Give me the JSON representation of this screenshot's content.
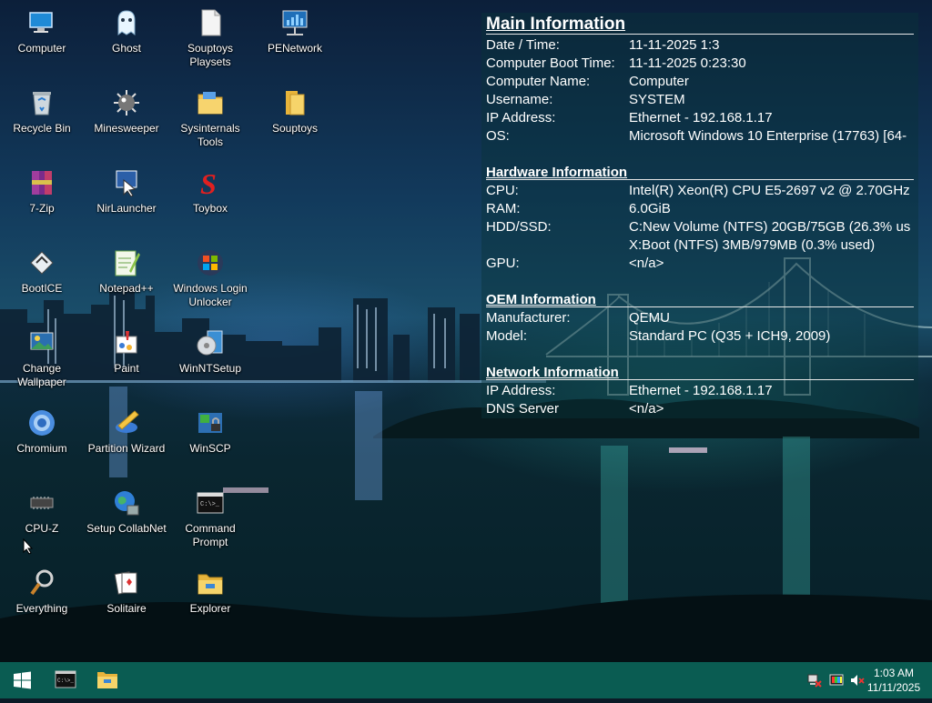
{
  "desktop": {
    "icons": [
      {
        "label": "Computer",
        "icon": "computer-icon"
      },
      {
        "label": "Ghost",
        "icon": "ghost-icon"
      },
      {
        "label": "Souptoys Playsets",
        "icon": "document-icon"
      },
      {
        "label": "PENetwork",
        "icon": "network-icon"
      },
      {
        "label": "Recycle Bin",
        "icon": "recycle-bin-icon"
      },
      {
        "label": "Minesweeper",
        "icon": "mine-icon"
      },
      {
        "label": "Sysinternals Tools",
        "icon": "folder-icon"
      },
      {
        "label": "Souptoys",
        "icon": "folder-icon"
      },
      {
        "label": "7-Zip",
        "icon": "archive-icon"
      },
      {
        "label": "NirLauncher",
        "icon": "launcher-icon"
      },
      {
        "label": "Toybox",
        "icon": "toybox-icon"
      },
      {
        "label": "BootICE",
        "icon": "bootice-icon"
      },
      {
        "label": "Notepad++",
        "icon": "notepad-icon"
      },
      {
        "label": "Windows Login Unlocker",
        "icon": "windows-logo-icon"
      },
      {
        "label": "Change Wallpaper",
        "icon": "wallpaper-icon"
      },
      {
        "label": "Paint",
        "icon": "paint-icon"
      },
      {
        "label": "WinNTSetup",
        "icon": "setup-icon"
      },
      {
        "label": "Chromium",
        "icon": "chromium-icon"
      },
      {
        "label": "Partition Wizard",
        "icon": "partition-icon"
      },
      {
        "label": "WinSCP",
        "icon": "winscp-icon"
      },
      {
        "label": "CPU-Z",
        "icon": "chip-icon"
      },
      {
        "label": "Setup CollabNet",
        "icon": "globe-icon"
      },
      {
        "label": "Command Prompt",
        "icon": "terminal-icon"
      },
      {
        "label": "Everything",
        "icon": "magnifier-icon"
      },
      {
        "label": "Solitaire",
        "icon": "cards-icon"
      },
      {
        "label": "Explorer",
        "icon": "folder-icon"
      }
    ]
  },
  "info": {
    "main": {
      "title": "Main Information",
      "rows": [
        {
          "k": "Date / Time:",
          "v": "11-11-2025 1:3"
        },
        {
          "k": "Computer Boot Time:",
          "v": "11-11-2025 0:23:30"
        },
        {
          "k": "Computer Name:",
          "v": "Computer"
        },
        {
          "k": "Username:",
          "v": "SYSTEM"
        },
        {
          "k": "IP Address:",
          "v": "Ethernet - 192.168.1.17"
        },
        {
          "k": "OS:",
          "v": "Microsoft Windows 10 Enterprise (17763) [64-"
        }
      ]
    },
    "hardware": {
      "title": "Hardware Information",
      "rows": [
        {
          "k": "CPU:",
          "v": "Intel(R) Xeon(R) CPU E5-2697 v2 @ 2.70GHz"
        },
        {
          "k": "RAM:",
          "v": "6.0GiB"
        },
        {
          "k": "HDD/SSD:",
          "v": "C:New Volume (NTFS) 20GB/75GB (26.3% us"
        },
        {
          "k": "",
          "v": "X:Boot (NTFS) 3MB/979MB (0.3% used)"
        },
        {
          "k": "GPU:",
          "v": "<n/a>"
        }
      ]
    },
    "oem": {
      "title": "OEM Information",
      "rows": [
        {
          "k": "Manufacturer:",
          "v": "QEMU"
        },
        {
          "k": "Model:",
          "v": "Standard PC (Q35 + ICH9, 2009)"
        }
      ]
    },
    "network": {
      "title": "Network Information",
      "rows": [
        {
          "k": "IP Address:",
          "v": "Ethernet - 192.168.1.17"
        },
        {
          "k": "DNS Server",
          "v": "<n/a>"
        }
      ]
    }
  },
  "taskbar": {
    "start": "windows-logo-icon",
    "pinned": [
      "terminal-icon",
      "folder-icon"
    ],
    "tray": [
      "network-disconnected-icon",
      "display-color-icon",
      "volume-muted-icon"
    ],
    "time": "1:03 AM",
    "date": "11/11/2025",
    "color": "#0a5c52"
  }
}
